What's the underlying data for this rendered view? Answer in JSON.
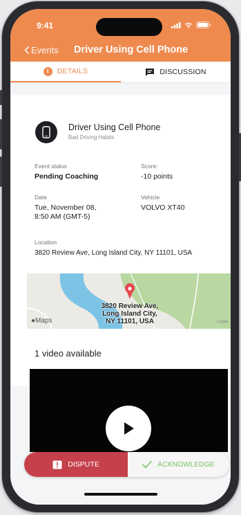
{
  "status_bar": {
    "time": "9:41"
  },
  "nav": {
    "back_label": "Events",
    "title": "Driver Using Cell Phone"
  },
  "tabs": {
    "details": "DETAILS",
    "discussion": "DISCUSSION"
  },
  "event": {
    "title": "Driver Using Cell Phone",
    "category": "Bad Driving Habits",
    "status_label": "Event status",
    "status_value": "Pending Coaching",
    "score_label": "Score:",
    "score_value": "-10 points",
    "date_label": "Date",
    "date_line1": "Tue, November 08,",
    "date_line2": "8:50 AM (GMT-5)",
    "vehicle_label": "Vehicle",
    "vehicle_value": "VOLVO XT40",
    "location_label": "Location",
    "location_value": "3820 Review Ave, Long Island City, NY 11101, USA"
  },
  "map": {
    "label_line1": "3820 Review Ave,",
    "label_line2": "Long Island City,",
    "label_line3": "NY 11101, USA",
    "logo": "Maps",
    "legal": "Legal"
  },
  "video": {
    "count_text": "1 video available"
  },
  "actions": {
    "dispute": "DISPUTE",
    "acknowledge": "ACKNOWLEDGE"
  },
  "colors": {
    "accent": "#ef8a4f",
    "dispute": "#c5404b",
    "acknowledge": "#79c167"
  }
}
